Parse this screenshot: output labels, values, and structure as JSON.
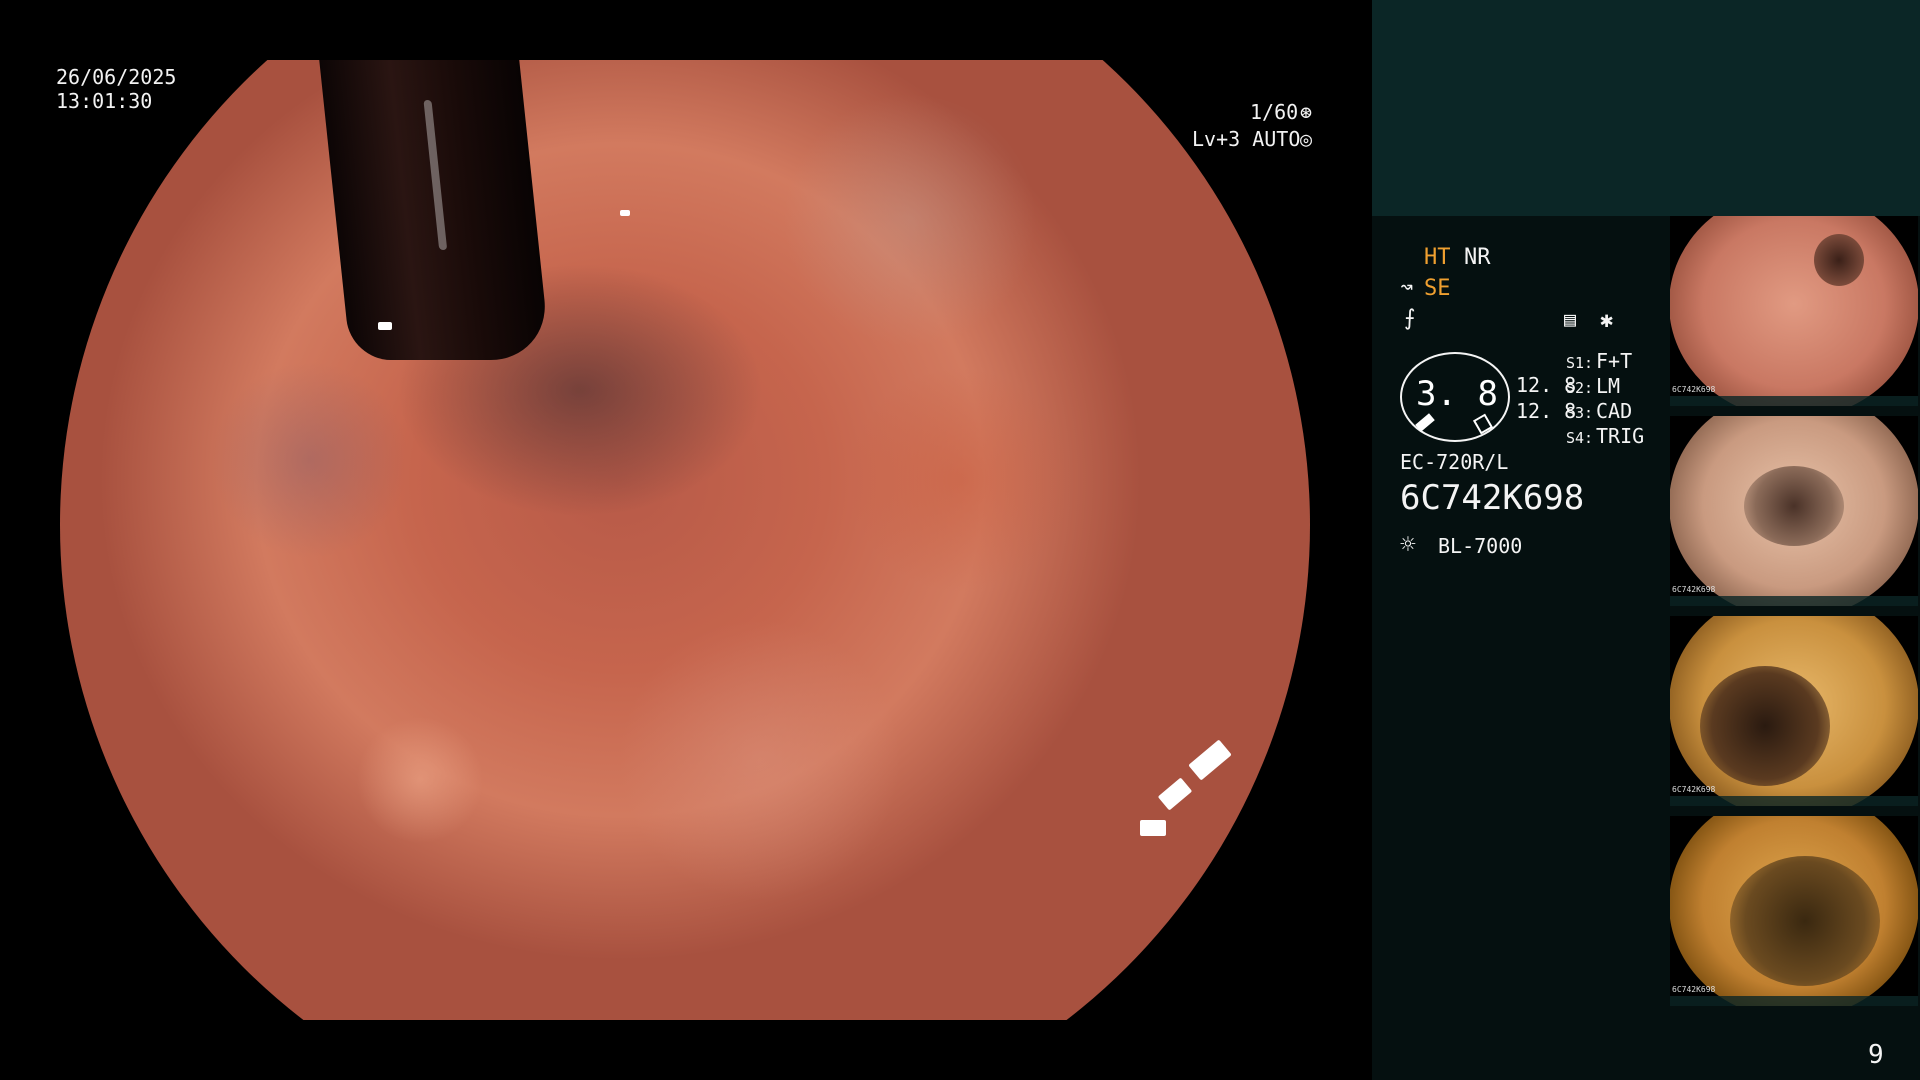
{
  "overlay": {
    "date": "26/06/2025",
    "time": "13:01:30",
    "shutter": "1/60",
    "iris": "Lv+3  AUTO"
  },
  "panel": {
    "mode_ht": "HT",
    "mode_nr": "NR",
    "mode_se": "SE",
    "gauge_value": "3. 8",
    "gauge_right_1": "12. 8",
    "gauge_right_2": "12. 8",
    "settings": [
      {
        "key": "S1:",
        "value": "F+T"
      },
      {
        "key": "S2:",
        "value": "LM"
      },
      {
        "key": "S3:",
        "value": "CAD"
      },
      {
        "key": "S4:",
        "value": "TRIG"
      }
    ],
    "scope_model": "EC-720R/L",
    "scope_serial": "6C742K698",
    "light_source": "BL-7000",
    "page_number": "9"
  },
  "colors": {
    "accent_orange": "#f0a030",
    "panel_bg": "#051010",
    "panel_top_bg": "#0b2626"
  },
  "icons": {
    "shutter_icon": "aperture",
    "iris_icon": "iris",
    "se_icon": "scope-curve",
    "f_icon": "f-stroke",
    "settings_icon": "menu-list",
    "asterisk_icon": "asterisk",
    "light_icon": "sun"
  },
  "thumbnails": [
    {
      "label": "6C742K698"
    },
    {
      "label": "6C742K698"
    },
    {
      "label": "6C742K698"
    },
    {
      "label": "6C742K698"
    }
  ]
}
